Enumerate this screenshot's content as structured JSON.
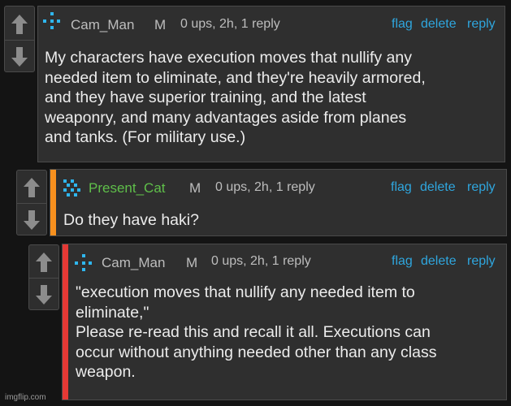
{
  "comments": [
    {
      "username": "Cam_Man",
      "rank": "M",
      "meta": "0 ups, 2h, 1 reply",
      "actions": {
        "flag": "flag",
        "delete": "delete",
        "reply": "reply"
      },
      "text": "My characters have execution moves that nullify any\nneeded item to eliminate, and they're heavily armored,\nand they have superior training, and the latest\nweaponry, and many advantages aside from planes\nand tanks. (For military use.)",
      "accent_color": null,
      "username_color": "#bdbdbd"
    },
    {
      "username": "Present_Cat",
      "rank": "M",
      "meta": "0 ups, 2h, 1 reply",
      "actions": {
        "flag": "flag",
        "delete": "delete",
        "reply": "reply"
      },
      "text": "Do they have haki?",
      "accent_color": "#f7901e",
      "username_color": "#5fbf4a"
    },
    {
      "username": "Cam_Man",
      "rank": "M",
      "meta": "0 ups, 2h, 1 reply",
      "actions": {
        "flag": "flag",
        "delete": "delete",
        "reply": "reply"
      },
      "text": "\"execution moves that nullify any needed item to\neliminate,\"\nPlease re-read this and recall it all. Executions can\noccur without anything needed other than any class\nweapon.",
      "accent_color": "#e53935",
      "username_color": "#bdbdbd"
    }
  ],
  "icons": {
    "upvote": "upvote-arrow-icon",
    "downvote": "downvote-arrow-icon",
    "avatar": "pixel-avatar-icon"
  },
  "colors": {
    "link": "#2fa6de",
    "avatar": "#2fb6ee"
  },
  "watermark": "imgflip.com"
}
